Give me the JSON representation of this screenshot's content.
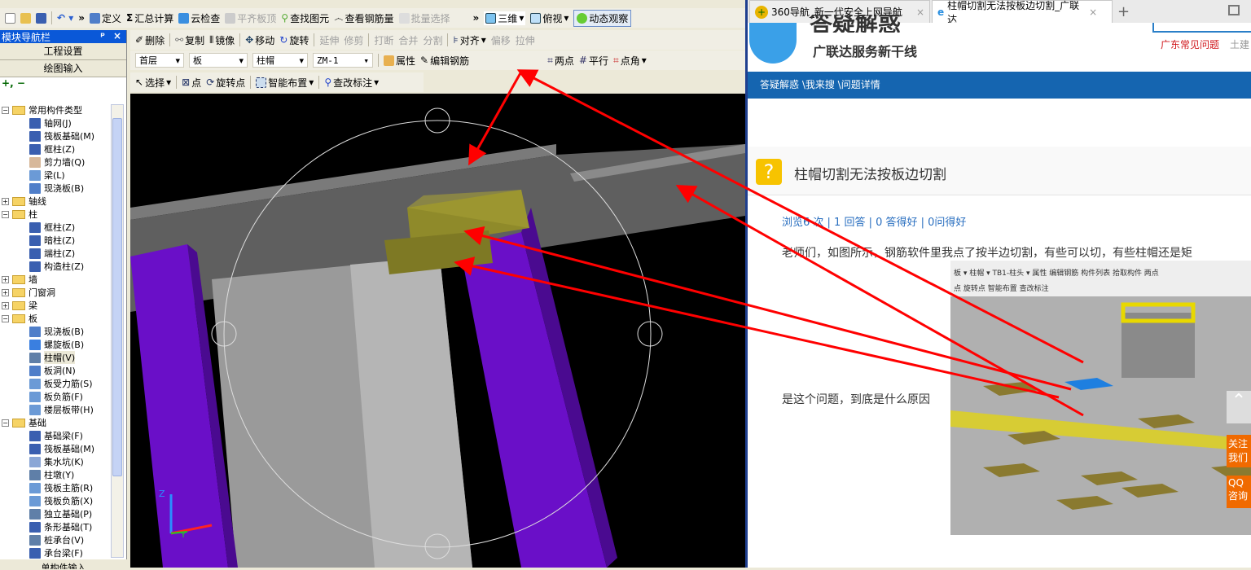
{
  "app": {
    "toolbar1": {
      "more": "»",
      "items": [
        {
          "label": "定义",
          "icon": "define-icon"
        },
        {
          "label": "汇总计算",
          "icon": "sigma-icon"
        },
        {
          "label": "云检查",
          "icon": "cloud-check-icon"
        },
        {
          "label": "平齐板顶",
          "icon": "align-top-icon",
          "disabled": true
        },
        {
          "label": "查找图元",
          "icon": "binoculars-icon"
        },
        {
          "label": "查看钢筋量",
          "icon": "glasses-icon"
        },
        {
          "label": "批量选择",
          "icon": "batch-select-icon",
          "disabled": true
        }
      ],
      "view": {
        "three_d": "三维",
        "top_view": "俯视",
        "orbit": "动态观察"
      }
    },
    "toolbar2": {
      "items": [
        {
          "label": "删除",
          "disabled": false
        },
        {
          "label": "复制",
          "disabled": false
        },
        {
          "label": "镜像",
          "disabled": false
        },
        {
          "label": "移动",
          "disabled": false
        },
        {
          "label": "旋转",
          "disabled": false
        },
        {
          "label": "延伸",
          "disabled": true
        },
        {
          "label": "修剪",
          "disabled": true
        },
        {
          "label": "打断",
          "disabled": true
        },
        {
          "label": "合并",
          "disabled": true
        },
        {
          "label": "分割",
          "disabled": true
        },
        {
          "label": "对齐",
          "disabled": false
        },
        {
          "label": "偏移",
          "disabled": true
        },
        {
          "label": "拉伸",
          "disabled": true
        }
      ]
    },
    "toolbar3": {
      "floor": "首层",
      "category": "板",
      "type": "柱帽",
      "name": "ZM-1",
      "property": "属性",
      "edit_rebar": "编辑钢筋",
      "two_points": "两点",
      "parallel": "平行",
      "point_angle": "点角"
    },
    "toolbar4": {
      "select": "选择",
      "point": "点",
      "rotate_point": "旋转点",
      "smart_layout": "智能布置",
      "edit_label": "查改标注"
    },
    "sidebar": {
      "title": "模块导航栏",
      "pin": "ᵖ",
      "close": "×",
      "project_settings": "工程设置",
      "drawing_input": "绘图输入",
      "single_input": "单构件输入",
      "tree": [
        {
          "label": "常用构件类型",
          "level": 0,
          "expanded": true
        },
        {
          "label": "轴网(J)",
          "level": 1,
          "color": "#3a5fb0"
        },
        {
          "label": "筏板基础(M)",
          "level": 1,
          "color": "#3a5fb0"
        },
        {
          "label": "框柱(Z)",
          "level": 1,
          "color": "#3a5fb0"
        },
        {
          "label": "剪力墙(Q)",
          "level": 1,
          "color": "#d7b89a"
        },
        {
          "label": "梁(L)",
          "level": 1,
          "color": "#6b9ad6"
        },
        {
          "label": "现浇板(B)",
          "level": 1,
          "color": "#4f7ec9"
        },
        {
          "label": "轴线",
          "level": 0,
          "expanded": false
        },
        {
          "label": "柱",
          "level": 0,
          "expanded": true
        },
        {
          "label": "框柱(Z)",
          "level": 1,
          "color": "#3a5fb0"
        },
        {
          "label": "暗柱(Z)",
          "level": 1,
          "color": "#3a5fb0"
        },
        {
          "label": "端柱(Z)",
          "level": 1,
          "color": "#3a5fb0"
        },
        {
          "label": "构造柱(Z)",
          "level": 1,
          "color": "#3a5fb0"
        },
        {
          "label": "墙",
          "level": 0,
          "expanded": false
        },
        {
          "label": "门窗洞",
          "level": 0,
          "expanded": false
        },
        {
          "label": "梁",
          "level": 0,
          "expanded": false
        },
        {
          "label": "板",
          "level": 0,
          "expanded": true
        },
        {
          "label": "现浇板(B)",
          "level": 1,
          "color": "#4f7ec9"
        },
        {
          "label": "螺旋板(B)",
          "level": 1,
          "color": "#3a7fe0"
        },
        {
          "label": "柱帽(V)",
          "level": 1,
          "color": "#5f7fa8",
          "selected": true
        },
        {
          "label": "板洞(N)",
          "level": 1,
          "color": "#4f7ec9"
        },
        {
          "label": "板受力筋(S)",
          "level": 1,
          "color": "#6b9ad6"
        },
        {
          "label": "板负筋(F)",
          "level": 1,
          "color": "#6b9ad6"
        },
        {
          "label": "楼层板带(H)",
          "level": 1,
          "color": "#6b9ad6"
        },
        {
          "label": "基础",
          "level": 0,
          "expanded": true
        },
        {
          "label": "基础梁(F)",
          "level": 1,
          "color": "#3a5fb0"
        },
        {
          "label": "筏板基础(M)",
          "level": 1,
          "color": "#3a5fb0"
        },
        {
          "label": "集水坑(K)",
          "level": 1,
          "color": "#8aa6d6"
        },
        {
          "label": "柱墩(Y)",
          "level": 1,
          "color": "#5f7fa8"
        },
        {
          "label": "筏板主筋(R)",
          "level": 1,
          "color": "#6b9ad6"
        },
        {
          "label": "筏板负筋(X)",
          "level": 1,
          "color": "#6b9ad6"
        },
        {
          "label": "独立基础(P)",
          "level": 1,
          "color": "#5f7fa8"
        },
        {
          "label": "条形基础(T)",
          "level": 1,
          "color": "#3a5fb0"
        },
        {
          "label": "桩承台(V)",
          "level": 1,
          "color": "#5f7fa8"
        },
        {
          "label": "承台梁(F)",
          "level": 1,
          "color": "#3a5fb0"
        }
      ]
    },
    "axes": {
      "z": "Z",
      "y": "Y"
    },
    "colors": {
      "slab": "#7a7a7a",
      "column": "#6a0fc8",
      "cap": "#8f8a2a",
      "annotation": "#ff0000"
    }
  },
  "browser": {
    "tabs": [
      {
        "label": "360导航_新一代安全上网导航",
        "active": false
      },
      {
        "label": "柱帽切割无法按板边切割_广联达",
        "active": true
      }
    ],
    "new_tab": "+",
    "logo_title": "答疑解惑",
    "logo_subtitle": "广联达服务新干线",
    "header_links": [
      "广东常见问题",
      "土建"
    ],
    "breadcrumb": "答疑解惑 \\我来搜 \\问题详情",
    "question": {
      "title": "柱帽切割无法按板边切割",
      "stats": "浏览6 次 | 1 回答 | 0 答得好 | 0问得好",
      "body": "老师们，如图所示，钢筋软件里我点了按半边切割，有些可以切，有些柱帽还是矩",
      "body2": "是这个问题，到底是什么原因"
    },
    "embedded": {
      "toolbar1": "板 ▾ 柱帽 ▾ TB1-柱头 ▾ 属性 编辑钢筋 构件列表 拾取构件 两点",
      "toolbar2": "点 旋转点 智能布置 查改标注"
    },
    "float": {
      "follow": "关注我们",
      "qq": "QQ咨询"
    }
  }
}
